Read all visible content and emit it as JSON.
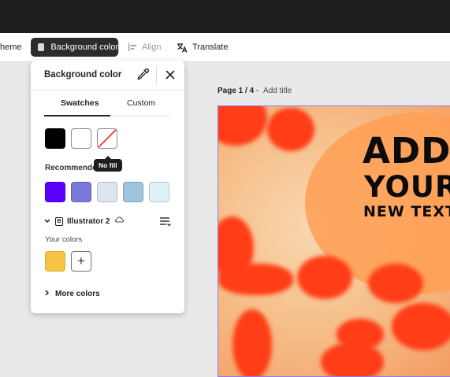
{
  "toolbar": {
    "theme_label": "heme",
    "background_color_label": "Background color",
    "align_label": "Align",
    "translate_label": "Translate"
  },
  "canvas": {
    "page_indicator": "Page 1 / 4",
    "separator": " - ",
    "add_title": "Add title",
    "headline_1": "ADD",
    "headline_2": "YOUR",
    "headline_3": "NEW TEXT"
  },
  "panel": {
    "title": "Background color",
    "tabs": [
      "Swatches",
      "Custom"
    ],
    "active_tab": "Swatches",
    "swatches": [
      {
        "name": "black",
        "color": "#000000"
      },
      {
        "name": "white",
        "color": "#ffffff"
      },
      {
        "name": "no-fill",
        "color": "none"
      }
    ],
    "tooltip": "No fill",
    "recommended_label": "Recommended",
    "recommended": [
      "#5b00ff",
      "#7b78dd",
      "#dfe4f2",
      "#9fc4dd",
      "#dff3f7"
    ],
    "library_name": "Illustrator 2",
    "your_colors_label": "Your colors",
    "your_colors": [
      "#f6c343"
    ],
    "add_symbol": "+",
    "more_colors": "More colors"
  },
  "colors": {
    "topbar": "#1e1e1e",
    "accent_dark": "#2c2c2c",
    "canvas_red": "#ff3d17",
    "canvas_orange": "#f5b17a"
  }
}
